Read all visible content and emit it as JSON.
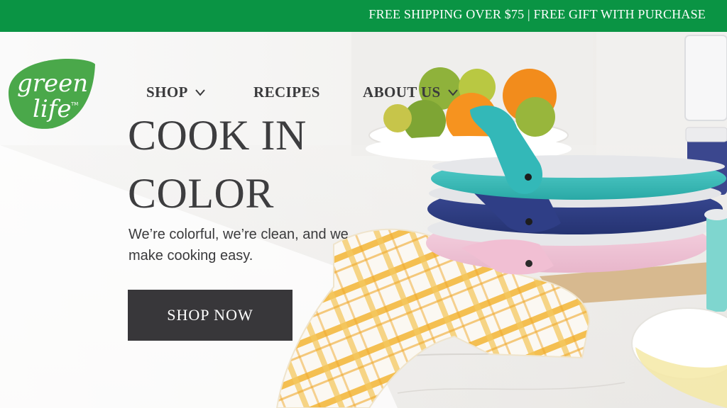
{
  "promo": {
    "text": "FREE SHIPPING OVER $75 | FREE GIFT WITH PURCHASE"
  },
  "brand": {
    "logo_line1": "green",
    "logo_line2": "life",
    "trademark": "TM",
    "logo_color": "#4aa84a"
  },
  "nav": {
    "items": [
      {
        "label": "SHOP",
        "has_dropdown": true,
        "icon": "chevron-down-icon"
      },
      {
        "label": "RECIPES",
        "has_dropdown": false
      },
      {
        "label": "ABOUT US",
        "has_dropdown": true,
        "icon": "chevron-down-icon"
      }
    ]
  },
  "hero": {
    "headline_line1": "COOK IN",
    "headline_line2": "COLOR",
    "subtext": "We’re colorful, we’re clean, and we make cooking easy.",
    "cta_label": "SHOP NOW"
  },
  "colors": {
    "promo_bar": "#0a9444",
    "headline": "#3d3d3f",
    "cta_bg": "#38373a",
    "pan_teal": "#3fc3c0",
    "pan_navy": "#2f3f86",
    "pan_pink": "#f0c6d8",
    "towel_yellow": "#f2b53a"
  }
}
